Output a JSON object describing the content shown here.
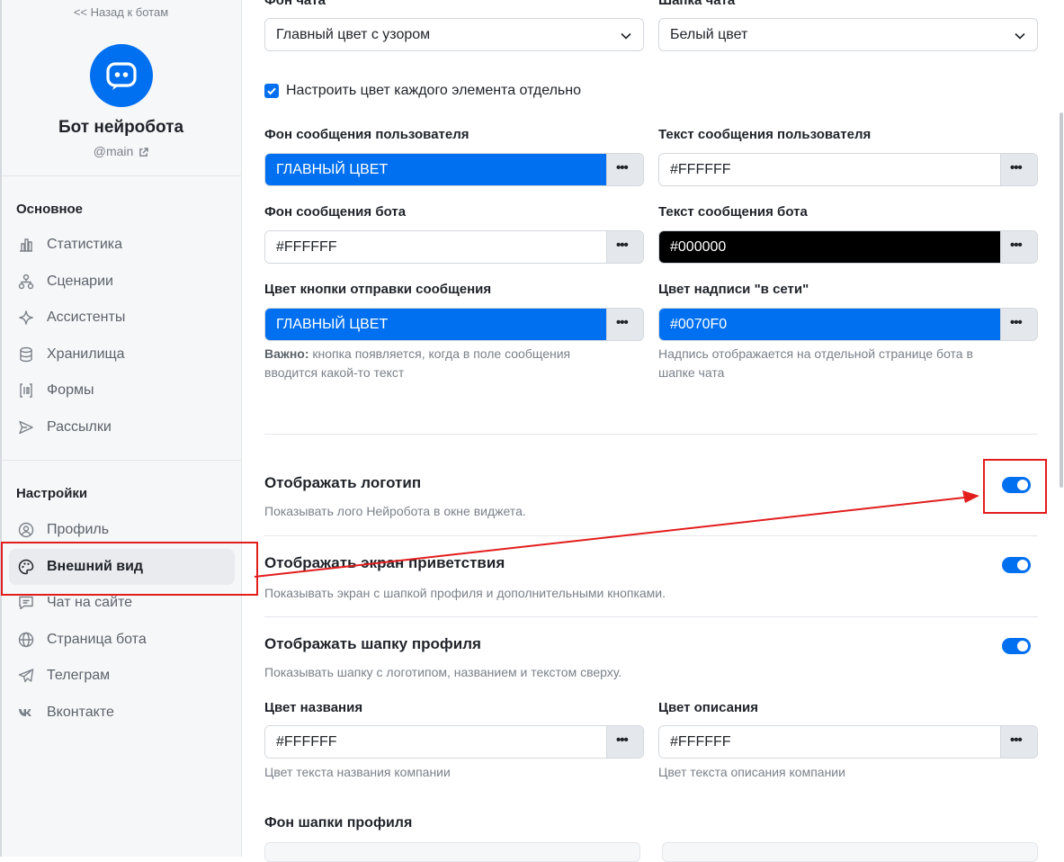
{
  "sidebar": {
    "back_link": "<< Назад к ботам",
    "bot_name": "Бот нейробота",
    "bot_handle": "@main",
    "section_main": "Основное",
    "main_items": [
      {
        "label": "Статистика",
        "icon": "bar-chart-icon"
      },
      {
        "label": "Сценарии",
        "icon": "flow-icon"
      },
      {
        "label": "Ассистенты",
        "icon": "sparkle-icon"
      },
      {
        "label": "Хранилища",
        "icon": "database-icon"
      },
      {
        "label": "Формы",
        "icon": "form-icon"
      },
      {
        "label": "Рассылки",
        "icon": "send-icon"
      }
    ],
    "section_settings": "Настройки",
    "settings_items": [
      {
        "label": "Профиль",
        "icon": "user-circle-icon"
      },
      {
        "label": "Внешний вид",
        "icon": "palette-icon",
        "active": true
      },
      {
        "label": "Чат на сайте",
        "icon": "chat-icon"
      },
      {
        "label": "Страница бота",
        "icon": "globe-icon"
      },
      {
        "label": "Телеграм",
        "icon": "telegram-icon"
      },
      {
        "label": "Вконтакте",
        "icon": "vk-icon"
      }
    ]
  },
  "main": {
    "chat_bg_label": "Фон чата",
    "chat_bg_value": "Главный цвет с узором",
    "chat_header_label": "Шапка чата",
    "chat_header_value": "Белый цвет",
    "custom_colors_label": "Настроить цвет каждого элемента отдельно",
    "custom_colors_checked": true,
    "color_fields": {
      "user_msg_bg": {
        "label": "Фон сообщения пользователя",
        "value": "ГЛАВНЫЙ ЦВЕТ",
        "swatch": "#0070f0",
        "text_color": "#ffffff"
      },
      "user_msg_text": {
        "label": "Текст сообщения пользователя",
        "value": "#FFFFFF",
        "swatch": "#ffffff",
        "text_color": "#1f2329"
      },
      "bot_msg_bg": {
        "label": "Фон сообщения бота",
        "value": "#FFFFFF",
        "swatch": "#ffffff",
        "text_color": "#1f2329"
      },
      "bot_msg_text": {
        "label": "Текст сообщения бота",
        "value": "#000000",
        "swatch": "#000000",
        "text_color": "#ffffff"
      },
      "send_button": {
        "label": "Цвет кнопки отправки сообщения",
        "value": "ГЛАВНЫЙ ЦВЕТ",
        "swatch": "#0070f0",
        "text_color": "#ffffff"
      },
      "online_label": {
        "label": "Цвет надписи \"в сети\"",
        "value": "#0070F0",
        "swatch": "#0070f0",
        "text_color": "#ffffff"
      },
      "title_color": {
        "label": "Цвет названия",
        "value": "#FFFFFF",
        "swatch": "#ffffff",
        "text_color": "#1f2329"
      },
      "desc_color": {
        "label": "Цвет описания",
        "value": "#FFFFFF",
        "swatch": "#ffffff",
        "text_color": "#1f2329"
      }
    },
    "send_hint_bold": "Важно:",
    "send_hint_line1": " кнопка появляется, когда в поле сообщения",
    "send_hint_line2": "вводится какой-то текст",
    "online_hint_line1": "Надпись отображается на отдельной странице бота в",
    "online_hint_line2": "шапке чата",
    "toggles": [
      {
        "title": "Отображать логотип",
        "desc": "Показывать лого Нейробота в окне виджета.",
        "on": true
      },
      {
        "title": "Отображать экран приветствия",
        "desc": "Показывать экран с шапкой профиля и дополнительными кнопками.",
        "on": true
      },
      {
        "title": "Отображать шапку профиля",
        "desc": "Показывать шапку с логотипом, названием и текстом сверху.",
        "on": true
      }
    ],
    "title_color_hint": "Цвет текста названия компании",
    "desc_color_hint": "Цвет текста описания компании",
    "profile_header_bg_label": "Фон шапки профиля",
    "more_glyph": "•••"
  },
  "colors": {
    "accent": "#0070f0",
    "annotation": "#e21d1d"
  }
}
